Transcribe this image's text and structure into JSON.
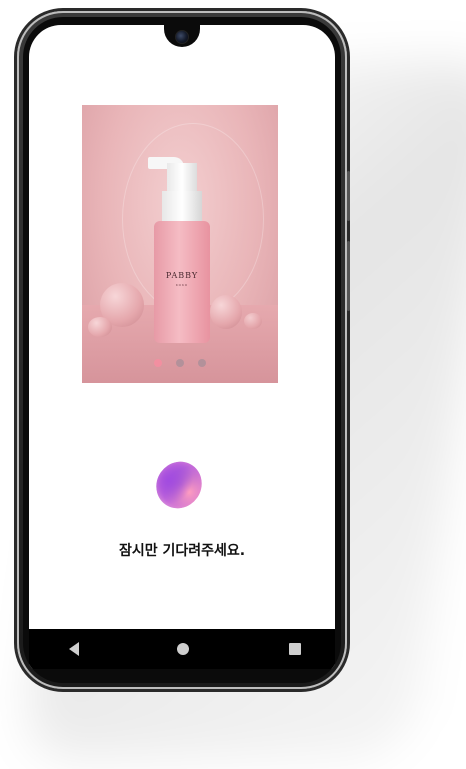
{
  "screen": {
    "loading_text": "잠시만 기다려주세요."
  },
  "product": {
    "brand": "PABBY",
    "brand_sub": "KOKO"
  },
  "carousel": {
    "slide_count": 3,
    "active_index": 0
  },
  "navbar": {
    "back_icon": "triangle-back-icon",
    "home_icon": "circle-home-icon",
    "recent_icon": "square-recent-icon"
  },
  "colors": {
    "phone_frame": "#1a1a1a",
    "dot_active": "#f28fa0",
    "dot_inactive": "#b3919a",
    "navbar_bg": "#000000"
  }
}
